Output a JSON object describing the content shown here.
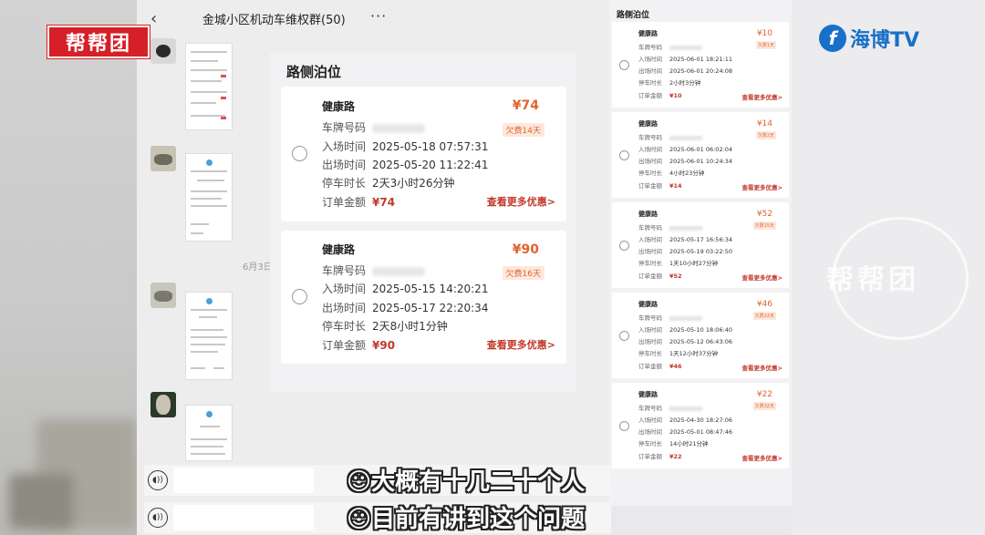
{
  "chat": {
    "title": "金城小区机动车维权群(50)",
    "back_icon": "chevron-left-icon",
    "more_icon": "more-dots-icon",
    "date_separator": "6月3日"
  },
  "logos": {
    "bangbangtuan": "帮帮团",
    "haibo": "海博TV",
    "haibo_mark": "f",
    "watermark": "帮帮团"
  },
  "main_panel": {
    "title": "路侧泊位",
    "orders": [
      {
        "street": "健康路",
        "price": "¥74",
        "owed": "欠费14天",
        "plate_label": "车牌号码",
        "entry_label": "入场时间",
        "entry_time": "2025-05-18 07:57:31",
        "exit_label": "出场时间",
        "exit_time": "2025-05-20 11:22:41",
        "duration_label": "停车时长",
        "duration": "2天3小时26分钟",
        "amount_label": "订单金额",
        "amount": "¥74",
        "more": "查看更多优惠>"
      },
      {
        "street": "健康路",
        "price": "¥90",
        "owed": "欠费16天",
        "plate_label": "车牌号码",
        "entry_label": "入场时间",
        "entry_time": "2025-05-15 14:20:21",
        "exit_label": "出场时间",
        "exit_time": "2025-05-17 22:20:34",
        "duration_label": "停车时长",
        "duration": "2天8小时1分钟",
        "amount_label": "订单金额",
        "amount": "¥90",
        "more": "查看更多优惠>"
      }
    ]
  },
  "side_panel": {
    "title": "路侧泊位",
    "orders": [
      {
        "street": "健康路",
        "price": "¥10",
        "owed": "欠费1天",
        "plate_label": "车牌号码",
        "entry_label": "入场时间",
        "entry_time": "2025-06-01 18:21:11",
        "exit_label": "出场时间",
        "exit_time": "2025-06-01 20:24:08",
        "duration_label": "停车时长",
        "duration": "2小时3分钟",
        "amount_label": "订单金额",
        "amount": "¥10",
        "more": "查看更多优惠>"
      },
      {
        "street": "健康路",
        "price": "¥14",
        "owed": "欠费2天",
        "plate_label": "车牌号码",
        "entry_label": "入场时间",
        "entry_time": "2025-06-01 06:02:04",
        "exit_label": "出场时间",
        "exit_time": "2025-06-01 10:24:34",
        "duration_label": "停车时长",
        "duration": "4小时23分钟",
        "amount_label": "订单金额",
        "amount": "¥14",
        "more": "查看更多优惠>"
      },
      {
        "street": "健康路",
        "price": "¥52",
        "owed": "欠费15天",
        "plate_label": "车牌号码",
        "entry_label": "入场时间",
        "entry_time": "2025-05-17 16:56:34",
        "exit_label": "出场时间",
        "exit_time": "2025-05-19 03:22:50",
        "duration_label": "停车时长",
        "duration": "1天10小时27分钟",
        "amount_label": "订单金额",
        "amount": "¥52",
        "more": "查看更多优惠>"
      },
      {
        "street": "健康路",
        "price": "¥46",
        "owed": "欠费22天",
        "plate_label": "车牌号码",
        "entry_label": "入场时间",
        "entry_time": "2025-05-10 18:06:40",
        "exit_label": "出场时间",
        "exit_time": "2025-05-12 06:43:06",
        "duration_label": "停车时长",
        "duration": "1天12小时37分钟",
        "amount_label": "订单金额",
        "amount": "¥46",
        "more": "查看更多优惠>"
      },
      {
        "street": "健康路",
        "price": "¥22",
        "owed": "欠费32天",
        "plate_label": "车牌号码",
        "entry_label": "入场时间",
        "entry_time": "2025-04-30 18:27:06",
        "exit_label": "出场时间",
        "exit_time": "2025-05-01 08:47:46",
        "duration_label": "停车时长",
        "duration": "14小时21分钟",
        "amount_label": "订单金额",
        "amount": "¥22",
        "more": "查看更多优惠>"
      }
    ]
  },
  "subtitles": {
    "line1": "☺大概有十几二十个人",
    "line2": "☺目前有讲到这个问题"
  },
  "voice_icon": "voice-icon",
  "colors": {
    "price": "#e0652f",
    "amount": "#c0392b",
    "brand_red": "#d62027",
    "brand_blue": "#1870c8"
  }
}
